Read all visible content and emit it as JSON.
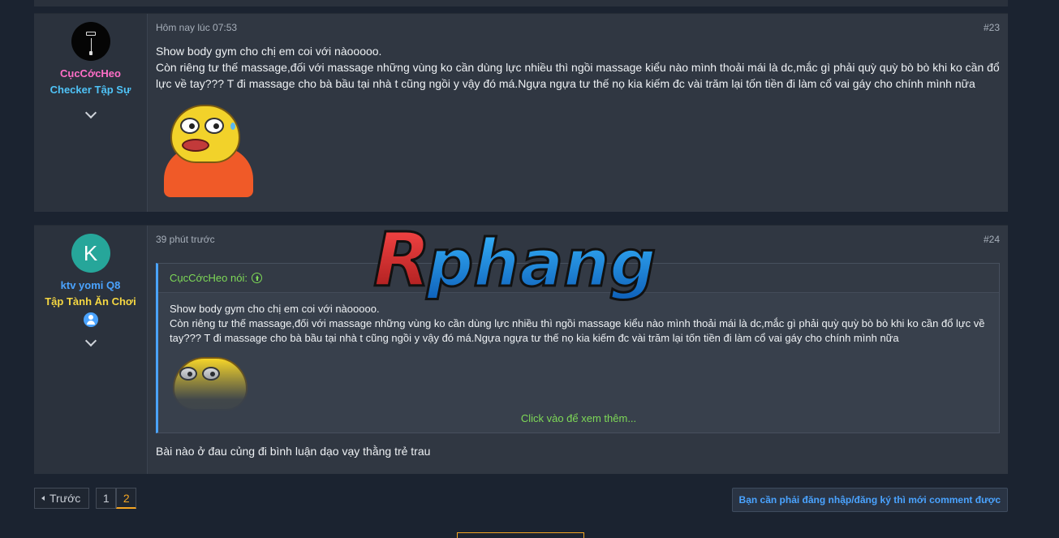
{
  "posts": [
    {
      "username": "CụcCớcHeo",
      "user_title": "Checker Tập Sự",
      "username_color": "#ff6ec7",
      "title_color": "#4fc3f7",
      "avatar_icon": "phone-charging-icon",
      "time": "Hôm nay lúc 07:53",
      "number": "#23",
      "body_line1": "Show body gym cho chị em coi với nàooooo.",
      "body_line2": "Còn riêng tư thế massage,đối với massage những vùng ko cần dùng lực nhiều thì ngồi massage kiểu nào mình thoải mái là dc,mắc gì phải quỳ quỳ bò bò khi ko cần đổ lực về tay??? T đi massage cho bà bầu tại nhà t cũng ngồi y vậy đó má.Ngựa ngựa tư thế nọ kia kiếm đc vài trăm lại tốn tiền đi làm cổ vai gáy cho chính mình nữa"
    },
    {
      "username": "ktv yomi Q8",
      "user_title": "Tập Tành Ăn Chơi",
      "username_color": "#4aa3ff",
      "title_color": "#f5d742",
      "avatar_letter": "K",
      "time": "39 phút trước",
      "number": "#24",
      "quote_author": "CụcCớcHeo nói:",
      "quote_line1": "Show body gym cho chị em coi với nàooooo.",
      "quote_line2": "Còn riêng tư thế massage,đối với massage những vùng ko cần dùng lực nhiều thì ngồi massage kiểu nào mình thoải mái là dc,mắc gì phải quỳ quỳ bò bò khi ko cần đổ lực về tay??? T đi massage cho bà bầu tại nhà t cũng ngồi y vậy đó má.Ngựa ngựa tư thế nọ kia kiếm đc vài trăm lại tốn tiền đi làm cổ vai gáy cho chính mình nữa",
      "quote_expand": "Click vào để xem thêm...",
      "reply": "Bài nào ở đau củng đi bình luận dạo vạy thằng trẻ trau"
    }
  ],
  "watermark": "Rphang",
  "pagination": {
    "prev_label": "Trước",
    "pages": [
      "1",
      "2"
    ],
    "current_page": "2"
  },
  "login_button": "Bạn cần phải đăng nhập/đăng ký thì mới comment được",
  "colors": {
    "background": "#1b2330",
    "accent_green": "#7ed957",
    "accent_orange": "#f5a623",
    "link_blue": "#4aa3ff"
  }
}
